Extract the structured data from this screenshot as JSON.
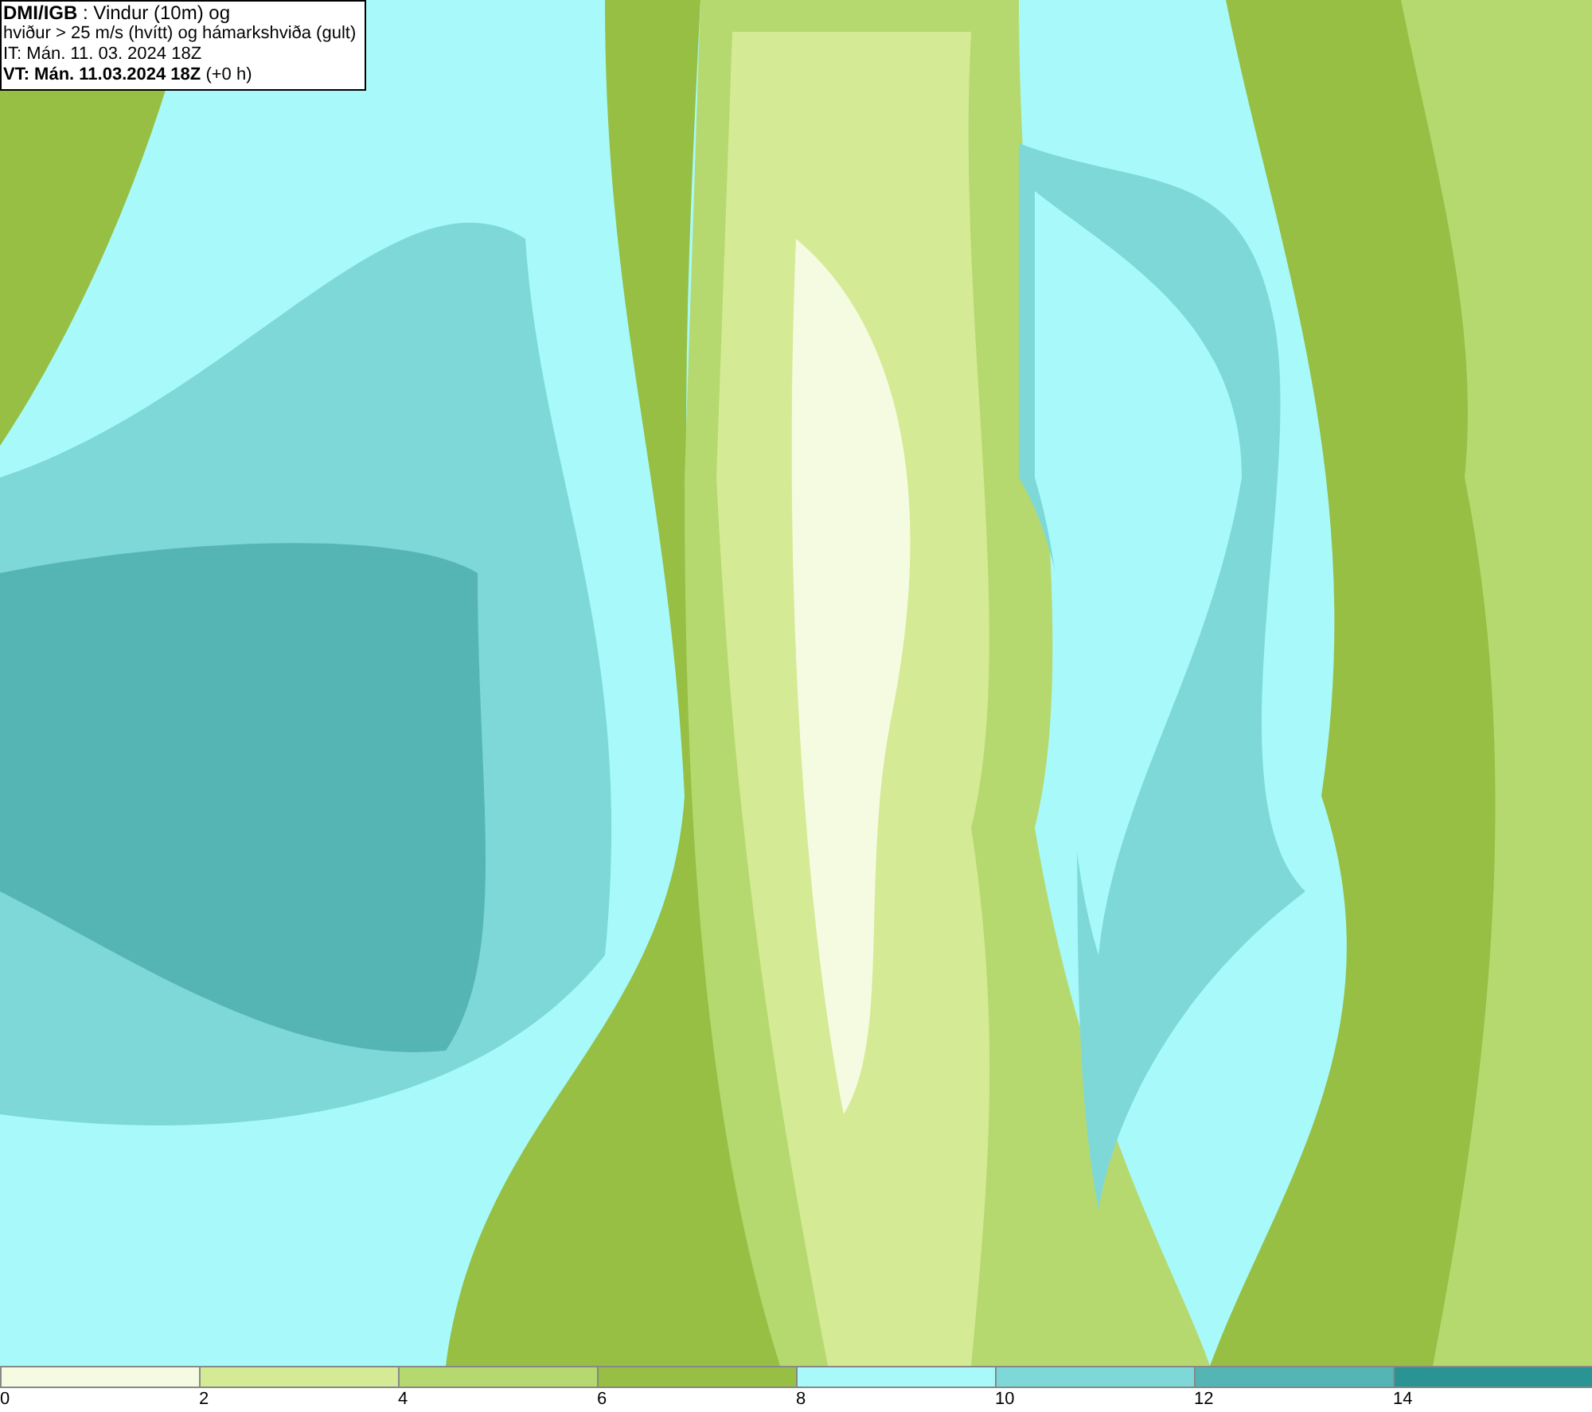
{
  "title_box": {
    "lines": [
      "**DMI/IGB** : Vindur (10m) og",
      "hviður > 25 m/s (hvítt) og hámarkshviða (gult)",
      "IT: Mán. 11. 03. 2024 18Z",
      "**VT: Mán. 11.03.2024 18Z** (+0 h)"
    ]
  },
  "legend": {
    "bins": [
      {
        "label": "0",
        "color": "#f5fbe0"
      },
      {
        "label": "2",
        "color": "#d5ea95"
      },
      {
        "label": "4",
        "color": "#b5d96f"
      },
      {
        "label": "6",
        "color": "#96bf44"
      },
      {
        "label": "8",
        "color": "#a8fafa"
      },
      {
        "label": "10",
        "color": "#7fd8d8"
      },
      {
        "label": "12",
        "color": "#55b5b5"
      },
      {
        "label": "14",
        "color": "#2a9393"
      }
    ]
  }
}
